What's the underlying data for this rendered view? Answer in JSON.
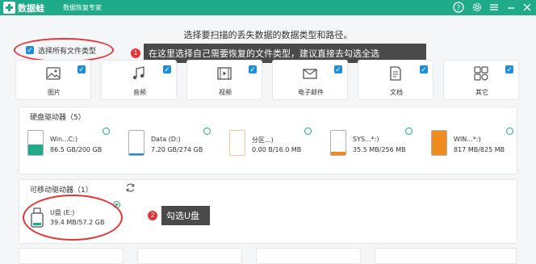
{
  "titlebar": {
    "app_name": "数据蛙",
    "subtitle": "数据恢复专家",
    "bg_color": "#1fab8a",
    "icons": [
      "help-icon",
      "settings-icon",
      "menu-icon",
      "minimize-icon",
      "close-icon"
    ]
  },
  "header": {
    "title": "选择要扫描的丢失数据的数据类型和路径。"
  },
  "select_all": {
    "label": "选择所有文件类型",
    "checked": true
  },
  "callout1": {
    "number": "1",
    "text": "在这里选择自己需要恢复的文件类型，建议直接去勾选全选"
  },
  "callout2": {
    "number": "2",
    "text": "勾选U盘"
  },
  "file_types": [
    {
      "label": "图片",
      "icon": "image-icon",
      "checked": true
    },
    {
      "label": "音频",
      "icon": "music-icon",
      "checked": true
    },
    {
      "label": "视频",
      "icon": "video-icon",
      "checked": true
    },
    {
      "label": "电子邮件",
      "icon": "email-icon",
      "checked": true
    },
    {
      "label": "文档",
      "icon": "document-icon",
      "checked": true
    },
    {
      "label": "其它",
      "icon": "other-icon",
      "checked": true
    }
  ],
  "hard_drives": {
    "title": "硬盘驱动器（5）",
    "items": [
      {
        "name": "Win...C:)",
        "size": "86.5 GB/200 GB",
        "fill_fraction": 0.43,
        "color": "#1fab8a"
      },
      {
        "name": "Data (D:)",
        "size": "7.20 GB/274 GB",
        "fill_fraction": 0.03,
        "color": "#1c8fd8"
      },
      {
        "name": "分区...)",
        "size": "0.00  B/16.0 MB",
        "fill_fraction": 0.0,
        "color": "#f0a64a"
      },
      {
        "name": "SYS...*:)",
        "size": "35.5 MB/256 MB",
        "fill_fraction": 0.14,
        "color": "#f08c1e"
      },
      {
        "name": "WIN...*:)",
        "size": "817 MB/825 MB",
        "fill_fraction": 0.99,
        "color": "#f08c1e"
      }
    ]
  },
  "removable": {
    "title": "可移动驱动器（1）",
    "items": [
      {
        "name": "U盘 (E:)",
        "size": "39.4 MB/57.2 GB",
        "selected": true
      }
    ]
  },
  "colors": {
    "accent": "#1fab8a",
    "checkbox": "#1c8fd8",
    "annotation_red": "#e53437",
    "callout_bg": "#4a4a4a"
  }
}
